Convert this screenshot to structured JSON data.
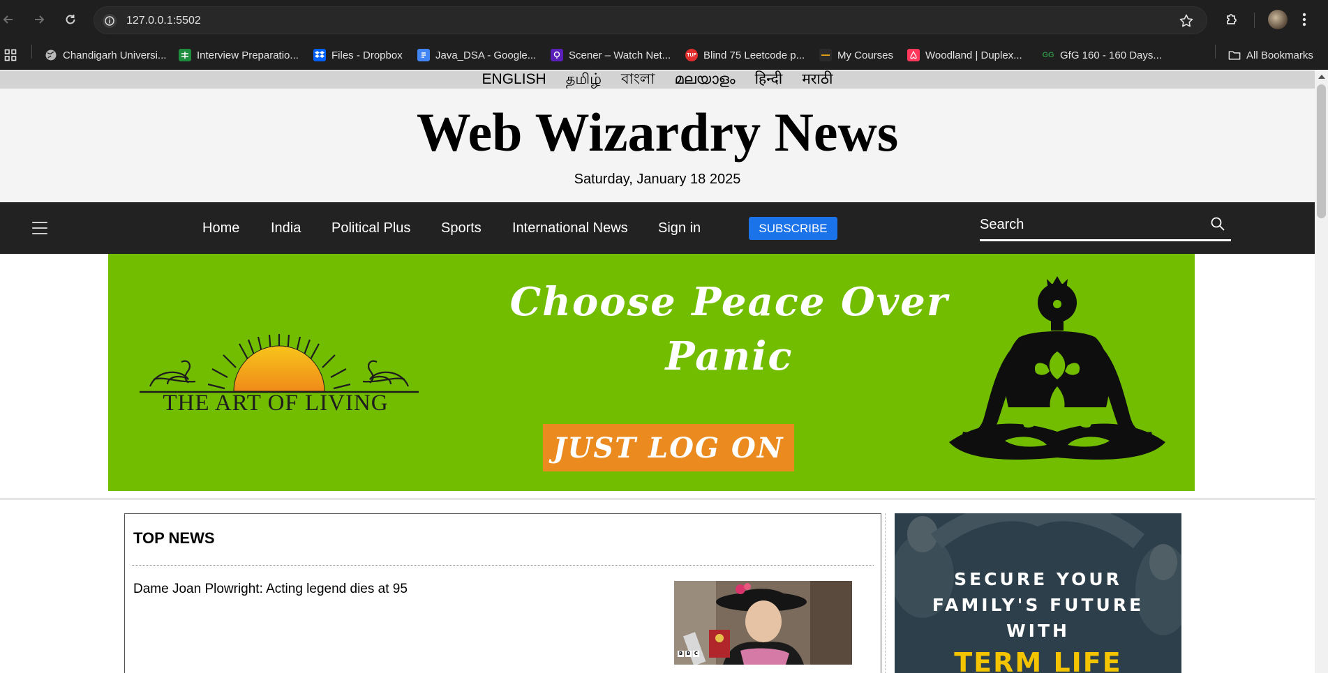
{
  "browser": {
    "url": "127.0.0.1:5502",
    "bookmarks": [
      {
        "label": "Chandigarh Universi...",
        "icon": "globe-icon"
      },
      {
        "label": "Interview Preparatio...",
        "icon": "sheets-icon"
      },
      {
        "label": "Files - Dropbox",
        "icon": "dropbox-icon"
      },
      {
        "label": "Java_DSA - Google...",
        "icon": "docs-icon"
      },
      {
        "label": "Scener – Watch Net...",
        "icon": "scener-icon"
      },
      {
        "label": "Blind 75 Leetcode p...",
        "icon": "tuf-icon"
      },
      {
        "label": "My Courses",
        "icon": "courses-icon"
      },
      {
        "label": "Woodland | Duplex...",
        "icon": "airbnb-icon"
      },
      {
        "label": "GfG 160 - 160 Days...",
        "icon": "gfg-icon"
      }
    ],
    "all_bookmarks": "All Bookmarks"
  },
  "languages": [
    "ENGLISH",
    "தமிழ்",
    "বাংলা",
    "മലയാളം",
    "हिन्दी",
    "मराठी"
  ],
  "masthead": {
    "title": "Web Wizardry News",
    "date": "Saturday, January 18 2025"
  },
  "nav": {
    "links": [
      "Home",
      "India",
      "Political Plus",
      "Sports",
      "International News",
      "Sign in"
    ],
    "subscribe": "SUBSCRIBE",
    "search_placeholder": "Search"
  },
  "banner": {
    "brand": "THE ART OF LIVING",
    "headline_line1": "Choose Peace Over",
    "headline_line2": "Panic",
    "cta": "JUST LOG ON"
  },
  "top_news": {
    "heading": "TOP NEWS",
    "story_title": "Dame Joan Plowright: Acting legend dies at 95",
    "photo_credit": "BBC"
  },
  "side_ad": {
    "line1": "SECURE YOUR",
    "line2": "FAMILY'S FUTURE",
    "line3": "WITH",
    "line4": "TERM LIFE"
  },
  "colors": {
    "navbar": "#222222",
    "subscribe": "#1a73e8",
    "banner_green": "#72bd00",
    "cta_orange": "#ea8a1f",
    "chrome": "#1f1f1f"
  }
}
